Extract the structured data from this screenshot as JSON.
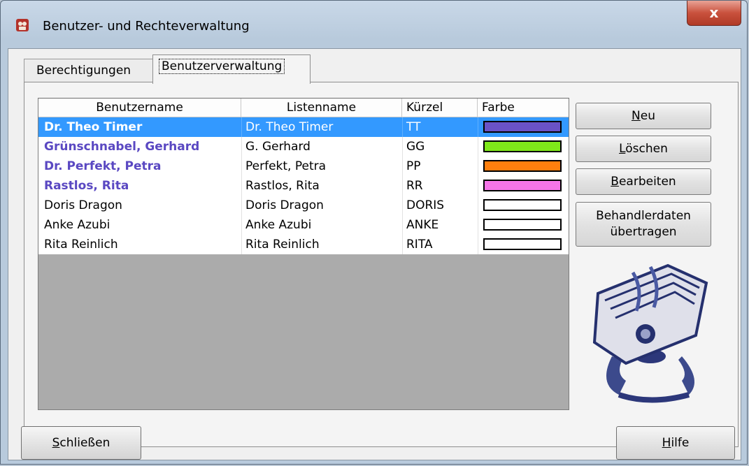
{
  "window": {
    "title": "Benutzer- und Rechteverwaltung",
    "close_label": "x"
  },
  "tabs": [
    {
      "label": "Berechtigungen"
    },
    {
      "label": "Benutzerverwaltung"
    }
  ],
  "grid": {
    "headers": [
      "Benutzername",
      "Listenname",
      "Kürzel",
      "Farbe"
    ],
    "rows": [
      {
        "username": "Dr. Theo Timer",
        "listname": "Dr. Theo Timer",
        "short": "TT",
        "color": "#6a52c6",
        "bold": true,
        "selected": true
      },
      {
        "username": "Grünschnabel, Gerhard",
        "listname": "G. Gerhard",
        "short": "GG",
        "color": "#7fe81a",
        "bold": true,
        "selected": false
      },
      {
        "username": "Dr. Perfekt, Petra",
        "listname": "Perfekt, Petra",
        "short": "PP",
        "color": "#ff7f0e",
        "bold": true,
        "selected": false
      },
      {
        "username": "Rastlos, Rita",
        "listname": "Rastlos, Rita",
        "short": "RR",
        "color": "#f575e8",
        "bold": true,
        "selected": false
      },
      {
        "username": "Doris Dragon",
        "listname": "Doris Dragon",
        "short": "DORIS",
        "color": "#ffffff",
        "bold": false,
        "selected": false
      },
      {
        "username": "Anke Azubi",
        "listname": "Anke Azubi",
        "short": "ANKE",
        "color": "#ffffff",
        "bold": false,
        "selected": false
      },
      {
        "username": "Rita Reinlich",
        "listname": "Rita Reinlich",
        "short": "RITA",
        "color": "#ffffff",
        "bold": false,
        "selected": false
      }
    ]
  },
  "buttons": {
    "new": {
      "mnemonic": "N",
      "rest": "eu"
    },
    "delete": {
      "mnemonic": "L",
      "rest": "öschen"
    },
    "edit": {
      "mnemonic": "B",
      "rest": "earbeiten"
    },
    "transfer": {
      "line1": "Behandlerdaten",
      "line2": "übertragen"
    },
    "close": {
      "mnemonic": "S",
      "rest": "chließen"
    },
    "help": {
      "mnemonic": "H",
      "rest": "ilfe"
    }
  },
  "colors": {
    "selection": "#3399ff",
    "bold_user": "#5a48c2",
    "grid_background": "#ababab"
  },
  "icons": {
    "app": "app-icon",
    "rolodex": "rolodex-icon"
  }
}
